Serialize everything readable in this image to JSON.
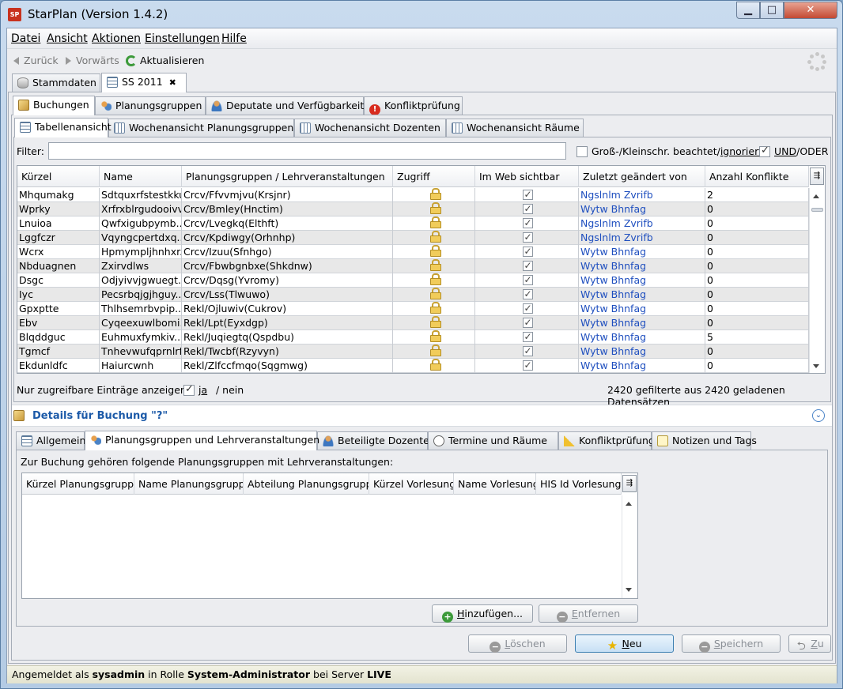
{
  "window": {
    "app_icon": "SP",
    "title": "StarPlan (Version 1.4.2)",
    "minimize_glyph": "▁",
    "maximize_glyph": "□",
    "close_glyph": "✕"
  },
  "menu": {
    "items": [
      "Datei",
      "Ansicht",
      "Aktionen",
      "Einstellungen",
      "Hilfe"
    ]
  },
  "toolbar": {
    "back": "Zurück",
    "forward": "Vorwärts",
    "refresh": "Aktualisieren"
  },
  "doc_tabs": [
    {
      "label": "Stammdaten",
      "icon": "database-icon"
    },
    {
      "label": "SS 2011",
      "icon": "table-icon",
      "close": "✖"
    }
  ],
  "main_tabs": [
    {
      "label": "Buchungen",
      "icon": "booking-icon"
    },
    {
      "label": "Planungsgruppen",
      "icon": "groups-icon"
    },
    {
      "label": "Deputate und Verfügbarkeit",
      "icon": "person-icon"
    },
    {
      "label": "Konfliktprüfung",
      "icon": "warning-icon",
      "glyph": "!"
    }
  ],
  "view_tabs": [
    {
      "label": "Tabellenansicht"
    },
    {
      "label": "Wochenansicht Planungsgruppen"
    },
    {
      "label": "Wochenansicht Dozenten"
    },
    {
      "label": "Wochenansicht Räume"
    }
  ],
  "filter": {
    "label": "Filter:",
    "value": "",
    "case_label_pre": "Groß-/Kleinschr. beachtet/",
    "case_label_u": "ignoriert",
    "und_label_u": "UND",
    "oder_label": "/ODER"
  },
  "table": {
    "columns": [
      "Kürzel",
      "Name",
      "Planungsgruppen / Lehrveranstaltungen",
      "Zugriff",
      "Im Web sichtbar",
      "Zuletzt geändert von",
      "Anzahl Konflikte"
    ],
    "corner_glyph": "⇶",
    "rows": [
      {
        "kuerzel": "Mhqumakg",
        "name": "Sdtquxrfstestkkud",
        "gruppen": "Crcv/Ffvvmjvu(Krsjnr)",
        "user": "Ngslnlm Zvrifb",
        "konflikte": "2"
      },
      {
        "kuerzel": "Wprky",
        "name": "Xrfrxblrgudooivv",
        "gruppen": "Crcv/Bmley(Hnctim)",
        "user": "Wytw Bhnfag",
        "konflikte": "0"
      },
      {
        "kuerzel": "Lnuioa",
        "name": "Qwfxigubpymb...",
        "gruppen": "Crcv/Lvegkq(Elthft)",
        "user": "Ngslnlm Zvrifb",
        "konflikte": "0"
      },
      {
        "kuerzel": "Lggfczr",
        "name": "Vqyngcpertdxq...",
        "gruppen": "Crcv/Kpdiwgy(Orhnhp)",
        "user": "Ngslnlm Zvrifb",
        "konflikte": "0"
      },
      {
        "kuerzel": "Wcrx",
        "name": "Hpmympljhnhxr...",
        "gruppen": "Crcv/Izuu(Sfnhgo)",
        "user": "Wytw Bhnfag",
        "konflikte": "0"
      },
      {
        "kuerzel": "Nbduagnen",
        "name": "Zxirvdlws",
        "gruppen": "Crcv/Fbwbgnbxe(Shkdnw)",
        "user": "Wytw Bhnfag",
        "konflikte": "0"
      },
      {
        "kuerzel": "Dsgc",
        "name": "Odjyivvjgwuegt...",
        "gruppen": "Crcv/Dqsg(Yvromy)",
        "user": "Wytw Bhnfag",
        "konflikte": "0"
      },
      {
        "kuerzel": "Iyc",
        "name": "Pecsrbqjgjhguy...",
        "gruppen": "Crcv/Lss(Tlwuwo)",
        "user": "Wytw Bhnfag",
        "konflikte": "0"
      },
      {
        "kuerzel": "Gpxptte",
        "name": "Thlhsemrbvpip...",
        "gruppen": "Rekl/Ojluwiv(Cukrov)",
        "user": "Wytw Bhnfag",
        "konflikte": "0"
      },
      {
        "kuerzel": "Ebv",
        "name": "Cyqeexuwlbomi...",
        "gruppen": "Rekl/Lpt(Eyxdgp)",
        "user": "Wytw Bhnfag",
        "konflikte": "0"
      },
      {
        "kuerzel": "Blqddguc",
        "name": "Euhmuxfymkiv...",
        "gruppen": "Rekl/Juqiegtq(Qspdbu)",
        "user": "Wytw Bhnfag",
        "konflikte": "5"
      },
      {
        "kuerzel": "Tgmcf",
        "name": "Tnhevwufqprnlrfy",
        "gruppen": "Rekl/Twcbf(Rzyvyn)",
        "user": "Wytw Bhnfag",
        "konflikte": "0"
      },
      {
        "kuerzel": "Ekdunldfc",
        "name": "Haiurcwnh",
        "gruppen": "Rekl/Zlfccfmqo(Sqgmwg)",
        "user": "Wytw Bhnfag",
        "konflikte": "0"
      }
    ]
  },
  "access_filter": {
    "label": "Nur zugreifbare Einträge anzeigen:",
    "ja": "ja",
    "nein": "/ nein",
    "count": "2420 gefilterte aus 2420 geladenen Datensätzen"
  },
  "details": {
    "title": "Details für Buchung \"?\"",
    "expand_glyph": "⌄",
    "tabs": [
      {
        "label": "Allgemein"
      },
      {
        "label": "Planungsgruppen und Lehrveranstaltungen"
      },
      {
        "label": "Beteiligte Dozenten"
      },
      {
        "label": "Termine und Räume"
      },
      {
        "label": "Konfliktprüfung"
      },
      {
        "label": "Notizen und Tags"
      }
    ],
    "description": "Zur Buchung gehören folgende Planungsgruppen mit Lehrveranstaltungen:",
    "columns": [
      "Kürzel Planungsgruppe",
      "Name Planungsgruppe",
      "Abteilung Planungsgruppe",
      "Kürzel Vorlesung",
      "Name Vorlesung",
      "HIS Id Vorlesung"
    ],
    "add_pre": "",
    "add_u": "H",
    "add_post": "inzufügen...",
    "remove_u": "E",
    "remove_post": "ntfernen",
    "plus_glyph": "+",
    "minus_glyph": "−"
  },
  "actions": {
    "delete_u": "L",
    "delete_post": "öschen",
    "new_u": "N",
    "new_post": "eu",
    "save_u": "S",
    "save_post": "peichern",
    "undo_u": "Z",
    "undo_post": "u",
    "star_glyph": "★",
    "undo_glyph": "⮌"
  },
  "status": {
    "pre": "Angemeldet als ",
    "user": "sysadmin",
    "mid": " in Rolle ",
    "role": "System-Administrator",
    "mid2": " bei Server ",
    "server": "LIVE"
  }
}
